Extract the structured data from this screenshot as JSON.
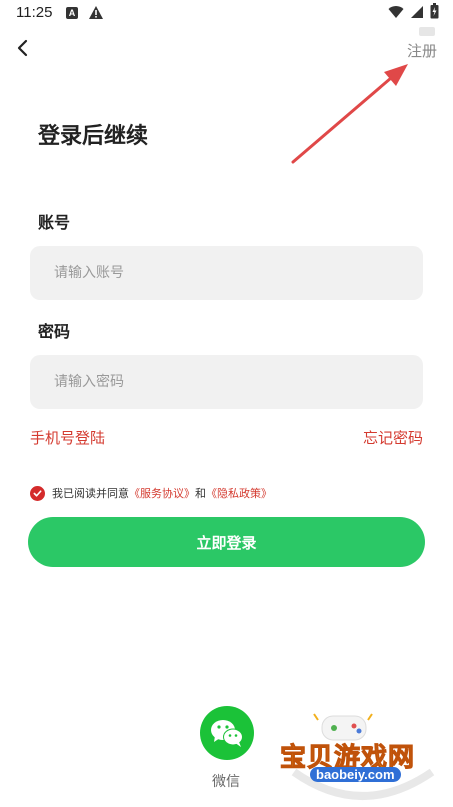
{
  "status_bar": {
    "time": "11:25",
    "icons": [
      "a-notification-icon",
      "warning-icon",
      "wifi-icon",
      "signal-icon",
      "battery-icon"
    ]
  },
  "header": {
    "back_icon": "chevron-left-icon",
    "register_label": "注册"
  },
  "title": "登录后继续",
  "account": {
    "label": "账号",
    "placeholder": "请输入账号",
    "value": ""
  },
  "password": {
    "label": "密码",
    "placeholder": "请输入密码",
    "value": ""
  },
  "links": {
    "phone_login": "手机号登陆",
    "forgot_password": "忘记密码"
  },
  "agreement": {
    "checked": true,
    "prefix": "我已阅读并同意",
    "service": "《服务协议》",
    "and": "和",
    "privacy": "《隐私政策》"
  },
  "login_button": "立即登录",
  "wechat": {
    "icon": "wechat-icon",
    "label": "微信"
  },
  "watermark": {
    "title": "宝贝游戏网",
    "url": "baobeiy.com"
  },
  "colors": {
    "primary_green": "#2bc866",
    "wechat_green": "#1bc238",
    "accent_red": "#d43a2f",
    "input_bg": "#f1f1f1"
  }
}
